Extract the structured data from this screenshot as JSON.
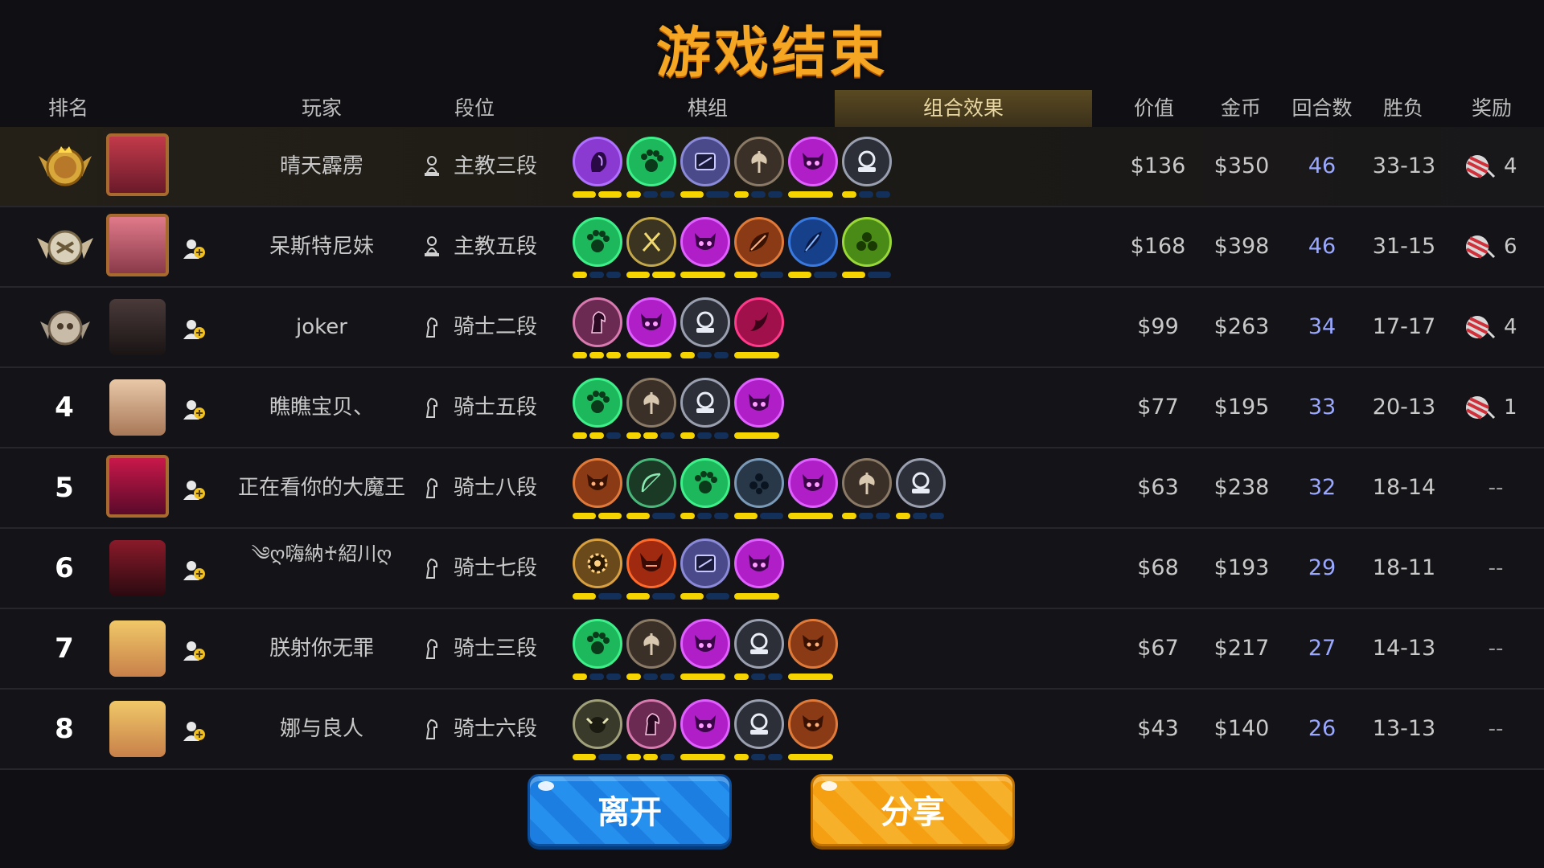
{
  "title": "游戏结束",
  "columns": {
    "rank": "排名",
    "player": "玩家",
    "tier": "段位",
    "pieces": "棋组",
    "synergy": "组合效果",
    "value": "价值",
    "gold": "金币",
    "rounds": "回合数",
    "winloss": "胜负",
    "reward": "奖励"
  },
  "colors": {
    "title": "#f5a623",
    "accent_tab": "#5a4a22",
    "rounds_text": "#9aa8ff",
    "pip_on": "#f5d400",
    "pip_off": "#12305a",
    "leave_button": "#1b7ee0",
    "share_button": "#f4a012"
  },
  "players": [
    {
      "rank": "",
      "medal": "gold-crown-medal",
      "name": "晴天霹雳",
      "tier_icon": "bishop-icon",
      "tier": "主教三段",
      "value": "$136",
      "gold": "$350",
      "rounds": "46",
      "winloss": "33-13",
      "reward": "4",
      "synergies": [
        {
          "icon": "demon-hand-icon",
          "color": "#8a3ad0",
          "border": "#b070ff",
          "pips": [
            1,
            1
          ]
        },
        {
          "icon": "paw-icon",
          "color": "#1db85c",
          "border": "#3ef08a",
          "pips": [
            1,
            0,
            0
          ]
        },
        {
          "icon": "mech-icon",
          "color": "#4a4a8a",
          "border": "#8a8ad8",
          "pips": [
            1,
            0
          ]
        },
        {
          "icon": "axe-icon",
          "color": "#3a3028",
          "border": "#8a7a66",
          "pips": [
            1,
            0,
            0
          ]
        },
        {
          "icon": "demon-skull-icon",
          "color": "#b01ec8",
          "border": "#e060ff",
          "pips": [
            1
          ]
        },
        {
          "icon": "knight-helm-icon",
          "color": "#2c2f38",
          "border": "#9aa0b0",
          "pips": [
            1,
            0,
            0
          ]
        }
      ]
    },
    {
      "rank": "",
      "medal": "silver-laurel-medal",
      "name": "呆斯特尼妹",
      "tier_icon": "bishop-icon",
      "tier": "主教五段",
      "value": "$168",
      "gold": "$398",
      "rounds": "46",
      "winloss": "31-15",
      "reward": "6",
      "synergies": [
        {
          "icon": "paw-icon",
          "color": "#1db85c",
          "border": "#3ef08a",
          "pips": [
            1,
            0,
            0
          ]
        },
        {
          "icon": "crossed-blades-icon",
          "color": "#3a3420",
          "border": "#c2a84a",
          "pips": [
            1,
            1
          ]
        },
        {
          "icon": "demon-skull-icon",
          "color": "#b01ec8",
          "border": "#e060ff",
          "pips": [
            1
          ]
        },
        {
          "icon": "leaf-icon",
          "color": "#8a3a14",
          "border": "#e07a3a",
          "pips": [
            1,
            0
          ]
        },
        {
          "icon": "feather-icon",
          "color": "#16408a",
          "border": "#3a7ae0",
          "pips": [
            1,
            0
          ]
        },
        {
          "icon": "elf-icon",
          "color": "#4a8a16",
          "border": "#9ad83a",
          "pips": [
            1,
            0
          ]
        }
      ]
    },
    {
      "rank": "",
      "medal": "bronze-skull-medal",
      "name": "joker",
      "tier_icon": "knight-icon",
      "tier": "骑士二段",
      "value": "$99",
      "gold": "$263",
      "rounds": "34",
      "winloss": "17-17",
      "reward": "4",
      "synergies": [
        {
          "icon": "horse-icon",
          "color": "#6a2a52",
          "border": "#d87ab0",
          "pips": [
            1,
            1,
            1
          ]
        },
        {
          "icon": "demon-skull-icon",
          "color": "#b01ec8",
          "border": "#e060ff",
          "pips": [
            1
          ]
        },
        {
          "icon": "knight-helm-icon",
          "color": "#2c2f38",
          "border": "#9aa0b0",
          "pips": [
            1,
            0,
            0
          ]
        },
        {
          "icon": "dragon-icon",
          "color": "#a0104a",
          "border": "#ff3a8a",
          "pips": [
            1
          ]
        }
      ]
    },
    {
      "rank": "4",
      "medal": "",
      "name": "瞧瞧宝贝、",
      "tier_icon": "knight-icon",
      "tier": "骑士五段",
      "value": "$77",
      "gold": "$195",
      "rounds": "33",
      "winloss": "20-13",
      "reward": "1",
      "synergies": [
        {
          "icon": "paw-icon",
          "color": "#1db85c",
          "border": "#3ef08a",
          "pips": [
            1,
            1,
            0
          ]
        },
        {
          "icon": "axe-icon",
          "color": "#3a3028",
          "border": "#8a7a66",
          "pips": [
            1,
            1,
            0
          ]
        },
        {
          "icon": "knight-helm-icon",
          "color": "#2c2f38",
          "border": "#9aa0b0",
          "pips": [
            1,
            0,
            0
          ]
        },
        {
          "icon": "demon-skull-icon",
          "color": "#b01ec8",
          "border": "#e060ff",
          "pips": [
            1
          ]
        }
      ]
    },
    {
      "rank": "5",
      "medal": "",
      "name": "正在看你的大魔王",
      "tier_icon": "knight-icon",
      "tier": "骑士八段",
      "value": "$63",
      "gold": "$238",
      "rounds": "32",
      "winloss": "18-14",
      "reward": "--",
      "synergies": [
        {
          "icon": "beast-mask-icon",
          "color": "#8a3a14",
          "border": "#e07a3a",
          "pips": [
            1,
            1
          ]
        },
        {
          "icon": "bow-icon",
          "color": "#1a3a26",
          "border": "#4ab87a",
          "pips": [
            1,
            0
          ]
        },
        {
          "icon": "paw-icon",
          "color": "#1db85c",
          "border": "#3ef08a",
          "pips": [
            1,
            0,
            0
          ]
        },
        {
          "icon": "cluster-icon",
          "color": "#283848",
          "border": "#7a9ab8",
          "pips": [
            1,
            0
          ]
        },
        {
          "icon": "demon-skull-icon",
          "color": "#b01ec8",
          "border": "#e060ff",
          "pips": [
            1
          ]
        },
        {
          "icon": "axe-icon",
          "color": "#3a3028",
          "border": "#8a7a66",
          "pips": [
            1,
            0,
            0
          ]
        },
        {
          "icon": "knight-helm-icon",
          "color": "#2c2f38",
          "border": "#9aa0b0",
          "pips": [
            1,
            0,
            0
          ]
        }
      ]
    },
    {
      "rank": "6",
      "medal": "",
      "name": "༄ღ嗨納♰紹川ღ",
      "tier_icon": "knight-icon",
      "tier": "骑士七段",
      "value": "$68",
      "gold": "$193",
      "rounds": "29",
      "winloss": "18-11",
      "reward": "--",
      "synergies": [
        {
          "icon": "gear-icon",
          "color": "#6a4a1a",
          "border": "#d8a040",
          "pips": [
            1,
            0
          ]
        },
        {
          "icon": "horned-mask-icon",
          "color": "#a02a10",
          "border": "#ff6a2a",
          "pips": [
            1,
            0
          ]
        },
        {
          "icon": "mech-icon",
          "color": "#4a4a8a",
          "border": "#8a8ad8",
          "pips": [
            1,
            0
          ]
        },
        {
          "icon": "demon-skull-icon",
          "color": "#b01ec8",
          "border": "#e060ff",
          "pips": [
            1
          ]
        }
      ]
    },
    {
      "rank": "7",
      "medal": "",
      "name": "朕射你无罪",
      "tier_icon": "knight-icon",
      "tier": "骑士三段",
      "value": "$67",
      "gold": "$217",
      "rounds": "27",
      "winloss": "14-13",
      "reward": "--",
      "synergies": [
        {
          "icon": "paw-icon",
          "color": "#1db85c",
          "border": "#3ef08a",
          "pips": [
            1,
            0,
            0
          ]
        },
        {
          "icon": "axe-icon",
          "color": "#3a3028",
          "border": "#8a7a66",
          "pips": [
            1,
            0,
            0
          ]
        },
        {
          "icon": "demon-skull-icon",
          "color": "#b01ec8",
          "border": "#e060ff",
          "pips": [
            1
          ]
        },
        {
          "icon": "knight-helm-icon",
          "color": "#2c2f38",
          "border": "#9aa0b0",
          "pips": [
            1,
            0,
            0
          ]
        },
        {
          "icon": "beast-mask-icon",
          "color": "#8a3a14",
          "border": "#e07a3a",
          "pips": [
            1
          ]
        }
      ]
    },
    {
      "rank": "8",
      "medal": "",
      "name": "娜与良人",
      "tier_icon": "knight-icon",
      "tier": "骑士六段",
      "value": "$43",
      "gold": "$140",
      "rounds": "26",
      "winloss": "13-13",
      "reward": "--",
      "synergies": [
        {
          "icon": "goblin-icon",
          "color": "#3a3a2a",
          "border": "#a0a07a",
          "pips": [
            1,
            0
          ]
        },
        {
          "icon": "horse-icon",
          "color": "#6a2a52",
          "border": "#d87ab0",
          "pips": [
            1,
            1,
            0
          ]
        },
        {
          "icon": "demon-skull-icon",
          "color": "#b01ec8",
          "border": "#e060ff",
          "pips": [
            1
          ]
        },
        {
          "icon": "knight-helm-icon",
          "color": "#2c2f38",
          "border": "#9aa0b0",
          "pips": [
            1,
            0,
            0
          ]
        },
        {
          "icon": "beast-mask-icon",
          "color": "#8a3a14",
          "border": "#e07a3a",
          "pips": [
            1
          ]
        }
      ]
    }
  ],
  "buttons": {
    "leave": "离开",
    "share": "分享"
  }
}
